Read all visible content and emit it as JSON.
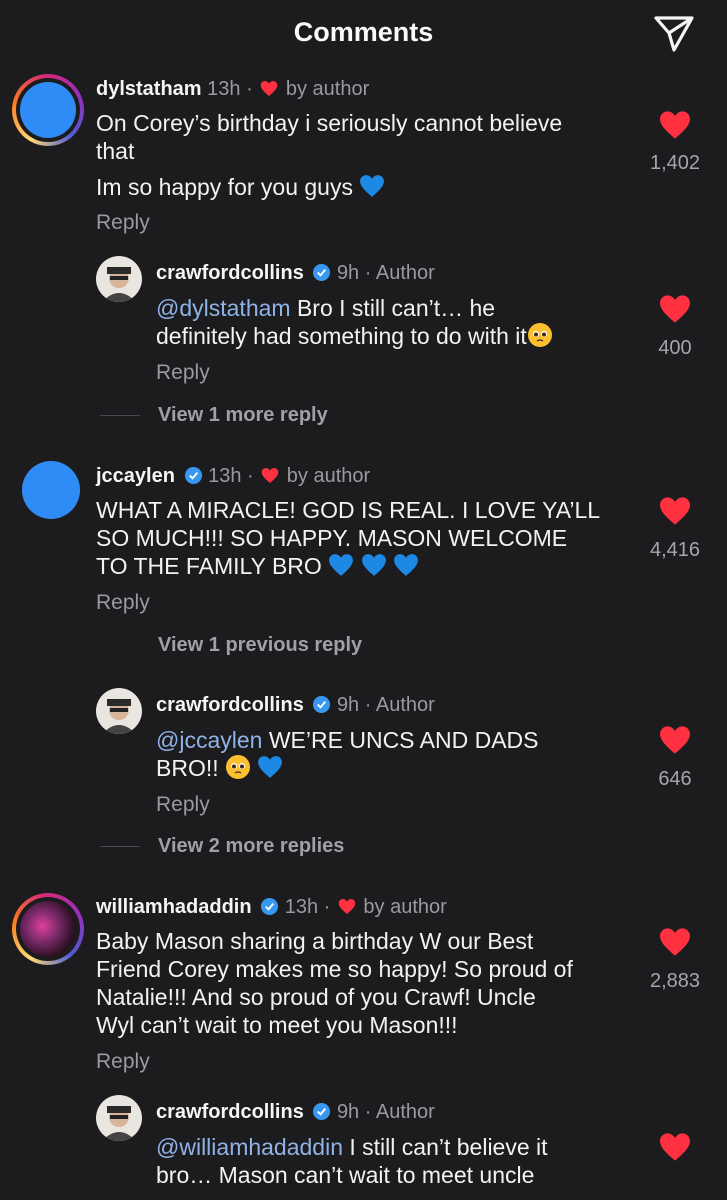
{
  "header": {
    "title": "Comments",
    "send_icon": "paper-plane-icon"
  },
  "accent": {
    "heart": "#ff3040",
    "verified": "#3897f0",
    "mention": "#8fb3e6"
  },
  "comments": [
    {
      "user": "dylstatham",
      "time": "13h",
      "liked_by_author": "by author",
      "lines": [
        "On Corey’s birthday i seriously cannot believe",
        "that",
        "Im so happy for you guys"
      ],
      "likes": "1,402",
      "reply": "Reply",
      "replies": [
        {
          "user": "crawfordcollins",
          "time": "9h",
          "tag": "Author",
          "mention": "@dylstatham",
          "text1": " Bro I still can’t… he",
          "text2": "definitely had something to do with it",
          "likes": "400",
          "reply": "Reply"
        }
      ],
      "view_more": "View 1 more reply"
    },
    {
      "user": "jccaylen",
      "time": "13h",
      "liked_by_author": "by author",
      "lines": [
        "WHAT A MIRACLE! GOD IS REAL. I LOVE YA’LL",
        "SO MUCH!!! SO HAPPY. MASON WELCOME",
        "TO THE FAMILY BRO"
      ],
      "likes": "4,416",
      "reply": "Reply",
      "view_previous": "View 1 previous reply",
      "replies": [
        {
          "user": "crawfordcollins",
          "time": "9h",
          "tag": "Author",
          "mention": "@jccaylen",
          "text1": " WE’RE UNCS AND DADS",
          "text2": "BRO!!",
          "likes": "646",
          "reply": "Reply"
        }
      ],
      "view_more": "View 2 more replies"
    },
    {
      "user": "williamhadaddin",
      "time": "13h",
      "liked_by_author": "by author",
      "lines": [
        "Baby Mason sharing a birthday W our Best",
        "Friend Corey makes me so happy! So proud of",
        "Natalie!!! And so proud of you Crawf! Uncle",
        "Wyl can’t wait to meet you Mason!!!"
      ],
      "likes": "2,883",
      "reply": "Reply",
      "replies": [
        {
          "user": "crawfordcollins",
          "time": "9h",
          "tag": "Author",
          "mention": "@williamhadaddin",
          "text1": " I still can’t believe it",
          "text2": "bro… Mason can’t wait to meet uncle",
          "likes": "",
          "reply": ""
        }
      ]
    }
  ]
}
